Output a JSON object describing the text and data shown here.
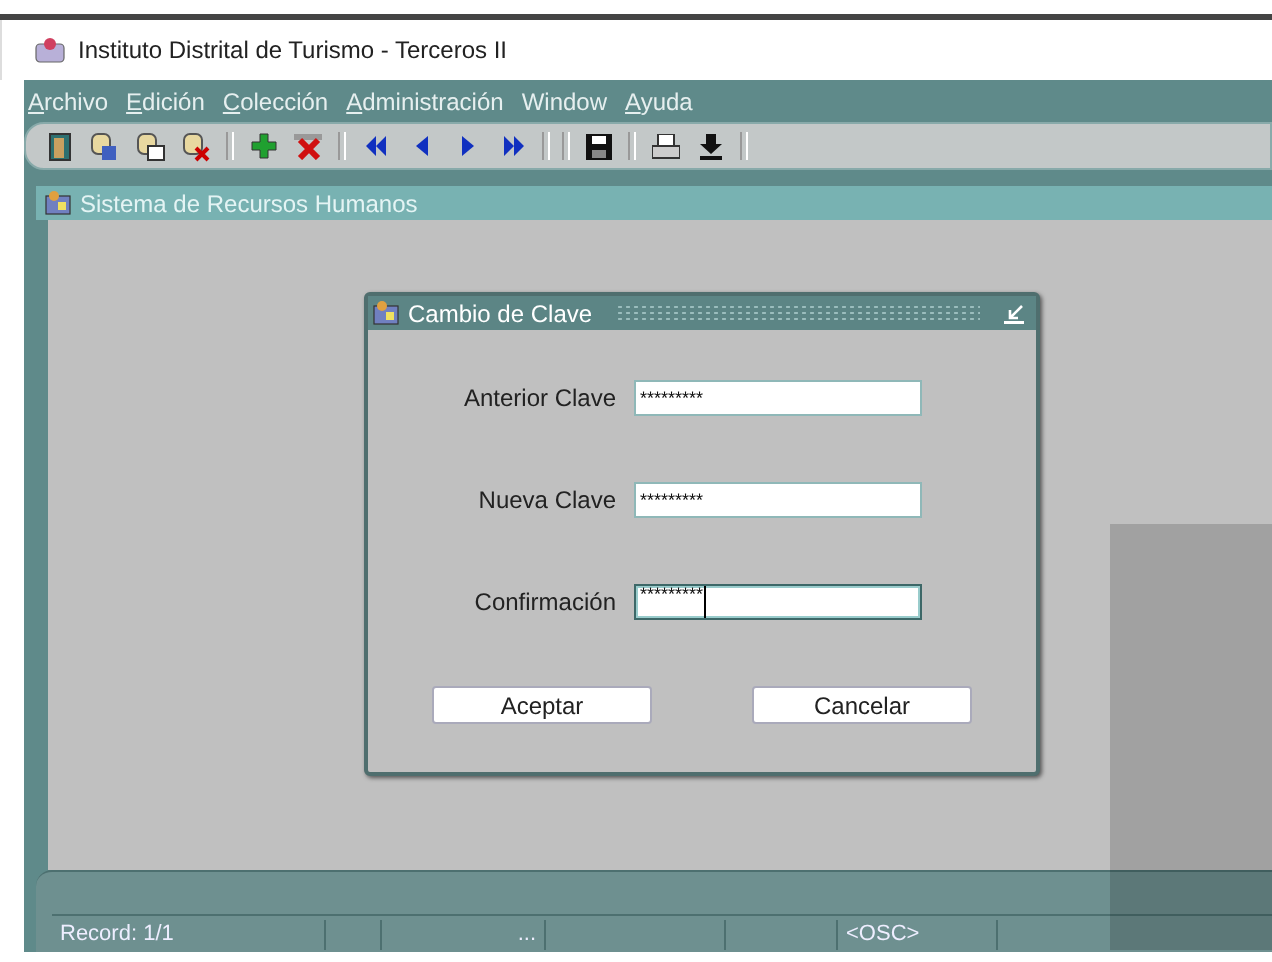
{
  "window": {
    "title": "Instituto Distrital de Turismo - Terceros II"
  },
  "menu": [
    {
      "label": "Archivo",
      "mnemonic": true
    },
    {
      "label": "Edición",
      "mnemonic": true
    },
    {
      "label": "Colección",
      "mnemonic": true
    },
    {
      "label": "Administración",
      "mnemonic": true
    },
    {
      "label": "Window",
      "mnemonic": false
    },
    {
      "label": "Ayuda",
      "mnemonic": true
    }
  ],
  "toolbar": [
    {
      "kind": "exit"
    },
    {
      "kind": "query"
    },
    {
      "kind": "query-table"
    },
    {
      "kind": "query-clear"
    },
    {
      "kind": "sep"
    },
    {
      "kind": "add"
    },
    {
      "kind": "delete"
    },
    {
      "kind": "sep"
    },
    {
      "kind": "first"
    },
    {
      "kind": "prev"
    },
    {
      "kind": "next"
    },
    {
      "kind": "last"
    },
    {
      "kind": "sep"
    },
    {
      "kind": "sep"
    },
    {
      "kind": "save"
    },
    {
      "kind": "sep"
    },
    {
      "kind": "print"
    },
    {
      "kind": "download"
    },
    {
      "kind": "sep"
    }
  ],
  "inner_window": {
    "title": "Sistema de Recursos Humanos"
  },
  "dialog": {
    "title": "Cambio de Clave",
    "fields": [
      {
        "label": "Anterior Clave",
        "value": "*********",
        "focused": false
      },
      {
        "label": "Nueva Clave",
        "value": "*********",
        "focused": false
      },
      {
        "label": "Confirmación",
        "value": "*********",
        "focused": true
      }
    ],
    "buttons": [
      "Aceptar",
      "Cancelar"
    ]
  },
  "status_bar": {
    "record": "Record: 1/1",
    "ellipsis": "...",
    "mode": "<OSC>"
  }
}
